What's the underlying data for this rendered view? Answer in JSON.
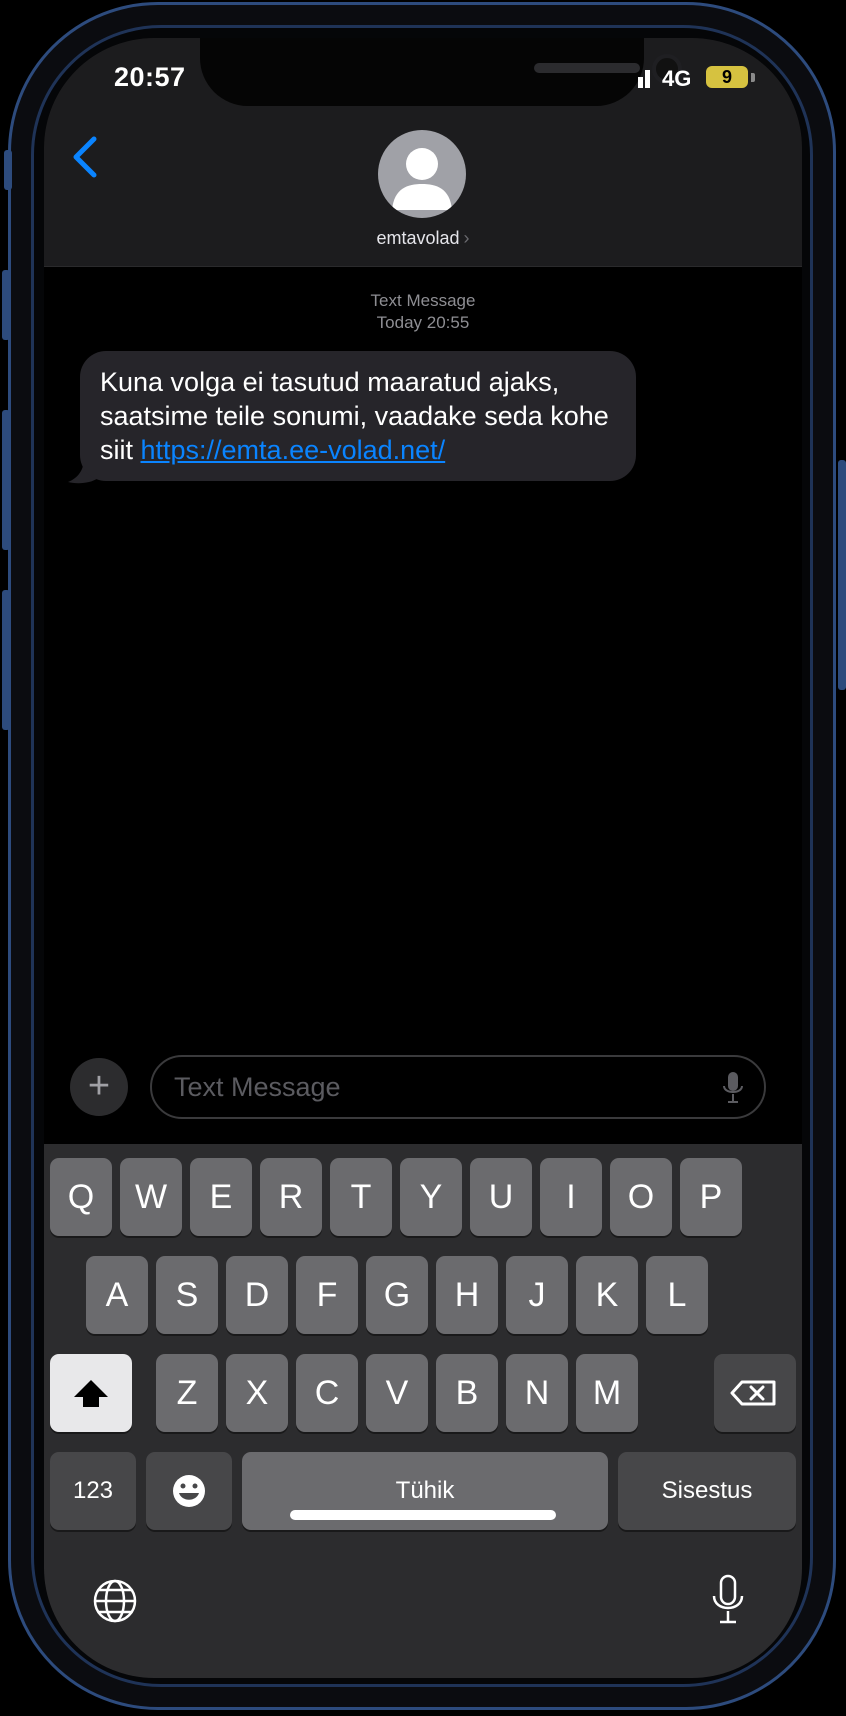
{
  "status_bar": {
    "time": "20:57",
    "network": "4G",
    "battery": "9"
  },
  "conversation": {
    "contact_name": "emtavolad"
  },
  "message": {
    "type_label": "Text Message",
    "timestamp": "Today 20:55",
    "text": "Kuna volga ei tasutud maaratud ajaks, saatsime teile sonumi, vaadake seda kohe siit ",
    "link": "https://emta.ee-volad.net/"
  },
  "composer": {
    "placeholder": "Text Message"
  },
  "keyboard": {
    "row1": [
      "Q",
      "W",
      "E",
      "R",
      "T",
      "Y",
      "U",
      "I",
      "O",
      "P"
    ],
    "row2": [
      "A",
      "S",
      "D",
      "F",
      "G",
      "H",
      "J",
      "K",
      "L"
    ],
    "row3": [
      "Z",
      "X",
      "C",
      "V",
      "B",
      "N",
      "M"
    ],
    "numbers_label": "123",
    "space_label": "Tühik",
    "return_label": "Sisestus"
  },
  "icons": [
    "back-chevron-icon",
    "contact-avatar-icon",
    "plus-icon",
    "microphone-icon",
    "shift-icon",
    "delete-icon",
    "emoji-icon",
    "globe-icon",
    "dictation-icon"
  ],
  "colors": {
    "accent": "#0a84ff",
    "bubble": "#26252a",
    "frame": "#2d4b7d"
  }
}
